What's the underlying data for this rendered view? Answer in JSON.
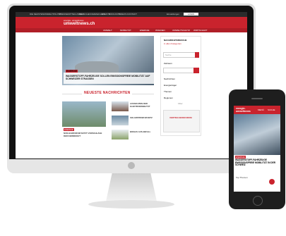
{
  "desktop": {
    "topbar_items": [
      "DIE NEUSTEN",
      "UMWELTPOLITIK",
      "PRESSEMITTEILUNGEN",
      "BRANCHENVERZEICHNIS",
      "EVENTS",
      "PODCASTS",
      "VIDEOS",
      "KONTAKT"
    ],
    "topbar_right": [
      "Einstellungen",
      "LOGIN"
    ],
    "logo": "energie- umweltnews",
    "logo_domain": "umweltnews.ch",
    "nav_items": [
      "UMWELT",
      "MOBILITÄT",
      "ENERGIE",
      "WOHNEN",
      "UMWELTSCHUTZ",
      "WIRTSCHAFT"
    ],
    "hero": {
      "tag": "ENERGIE",
      "headline": "WASSERSTOFF-FAHRZEUGE SOLLEN EMISSIONSFREIE MOBILITÄT AUF SCHWEIZER STRASSEN"
    },
    "sidebar": {
      "title": "NACHRICHTENSUCHE",
      "subtitle": "in allen Kategorien",
      "search_placeholder": "Suche",
      "filter_label": "Zeitraum",
      "categories": [
        "Nachrichten",
        "Energieträger",
        "Themen",
        "Regionen"
      ],
      "reset_label": "Filter"
    },
    "section_title": "NEUESTE NACHRICHTEN",
    "news": [
      {
        "tag": "ENERGIE",
        "title": "NUKLEARFORUM NUTZT VORSCHLÄGE DER KERNKRAFT"
      },
      {
        "tag": "MOBILITÄT",
        "title": "AUSSICHTEN DER ELEKTROMOBILITÄT"
      },
      {
        "tag": "ENERGIE",
        "title": "SOLARSTROM IM NETZ"
      },
      {
        "tag": "UMWELT",
        "title": "BIOGAS AUS ABFALL"
      }
    ],
    "ad": "VERTRAUENSFORUM"
  },
  "mobile": {
    "logo": "energie- umweltnews",
    "nav": [
      "MENÜ",
      "SUCHE"
    ],
    "hero_tag": "ENERGIE",
    "hero_headline": "WASSERSTOFF-FAHRZEUGE EMISSIONSFREIE MOBILITÄT IN DER SCHWEIZ",
    "footer_label": "Top Themen"
  },
  "colors": {
    "brand_red": "#c9232d",
    "dark": "#2b2b2b"
  }
}
